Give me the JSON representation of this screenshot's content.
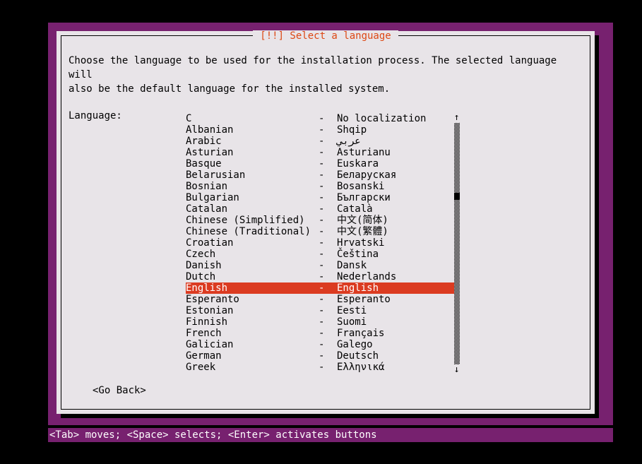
{
  "dialog": {
    "title": "[!!] Select a language",
    "title_color": "#DD4814",
    "background_color": "#E8E4E8",
    "backdrop_color": "#77216F",
    "intro": "Choose the language to be used for the installation process. The selected language will\nalso be the default language for the installed system.",
    "list_label": "Language:",
    "go_back_label": "<Go Back>"
  },
  "languages": [
    {
      "name": "C",
      "dash": "-",
      "native": "No localization",
      "selected": false
    },
    {
      "name": "Albanian",
      "dash": "-",
      "native": "Shqip",
      "selected": false
    },
    {
      "name": "Arabic",
      "dash": "-",
      "native": "عربي",
      "selected": false
    },
    {
      "name": "Asturian",
      "dash": "-",
      "native": "Asturianu",
      "selected": false
    },
    {
      "name": "Basque",
      "dash": "-",
      "native": "Euskara",
      "selected": false
    },
    {
      "name": "Belarusian",
      "dash": "-",
      "native": "Беларуская",
      "selected": false
    },
    {
      "name": "Bosnian",
      "dash": "-",
      "native": "Bosanski",
      "selected": false
    },
    {
      "name": "Bulgarian",
      "dash": "-",
      "native": "Български",
      "selected": false
    },
    {
      "name": "Catalan",
      "dash": "-",
      "native": "Català",
      "selected": false
    },
    {
      "name": "Chinese (Simplified)",
      "dash": "-",
      "native": "中文(简体)",
      "selected": false
    },
    {
      "name": "Chinese (Traditional)",
      "dash": "-",
      "native": "中文(繁體)",
      "selected": false
    },
    {
      "name": "Croatian",
      "dash": "-",
      "native": "Hrvatski",
      "selected": false
    },
    {
      "name": "Czech",
      "dash": "-",
      "native": "Čeština",
      "selected": false
    },
    {
      "name": "Danish",
      "dash": "-",
      "native": "Dansk",
      "selected": false
    },
    {
      "name": "Dutch",
      "dash": "-",
      "native": "Nederlands",
      "selected": false
    },
    {
      "name": "English",
      "dash": "-",
      "native": "English",
      "selected": true
    },
    {
      "name": "Esperanto",
      "dash": "-",
      "native": "Esperanto",
      "selected": false
    },
    {
      "name": "Estonian",
      "dash": "-",
      "native": "Eesti",
      "selected": false
    },
    {
      "name": "Finnish",
      "dash": "-",
      "native": "Suomi",
      "selected": false
    },
    {
      "name": "French",
      "dash": "-",
      "native": "Français",
      "selected": false
    },
    {
      "name": "Galician",
      "dash": "-",
      "native": "Galego",
      "selected": false
    },
    {
      "name": "German",
      "dash": "-",
      "native": "Deutsch",
      "selected": false
    },
    {
      "name": "Greek",
      "dash": "-",
      "native": "Ελληνικά",
      "selected": false
    }
  ],
  "selection": {
    "highlight_color": "#DB3B21",
    "highlight_text_color": "#FFFFFF",
    "selected_language": "English"
  },
  "scrollbar": {
    "up_arrow": "↑",
    "down_arrow": "↓",
    "thumb_position_percent": 29
  },
  "statusbar": {
    "text": "<Tab> moves; <Space> selects; <Enter> activates buttons",
    "background_color": "#77216F",
    "text_color": "#FFFFFF"
  }
}
